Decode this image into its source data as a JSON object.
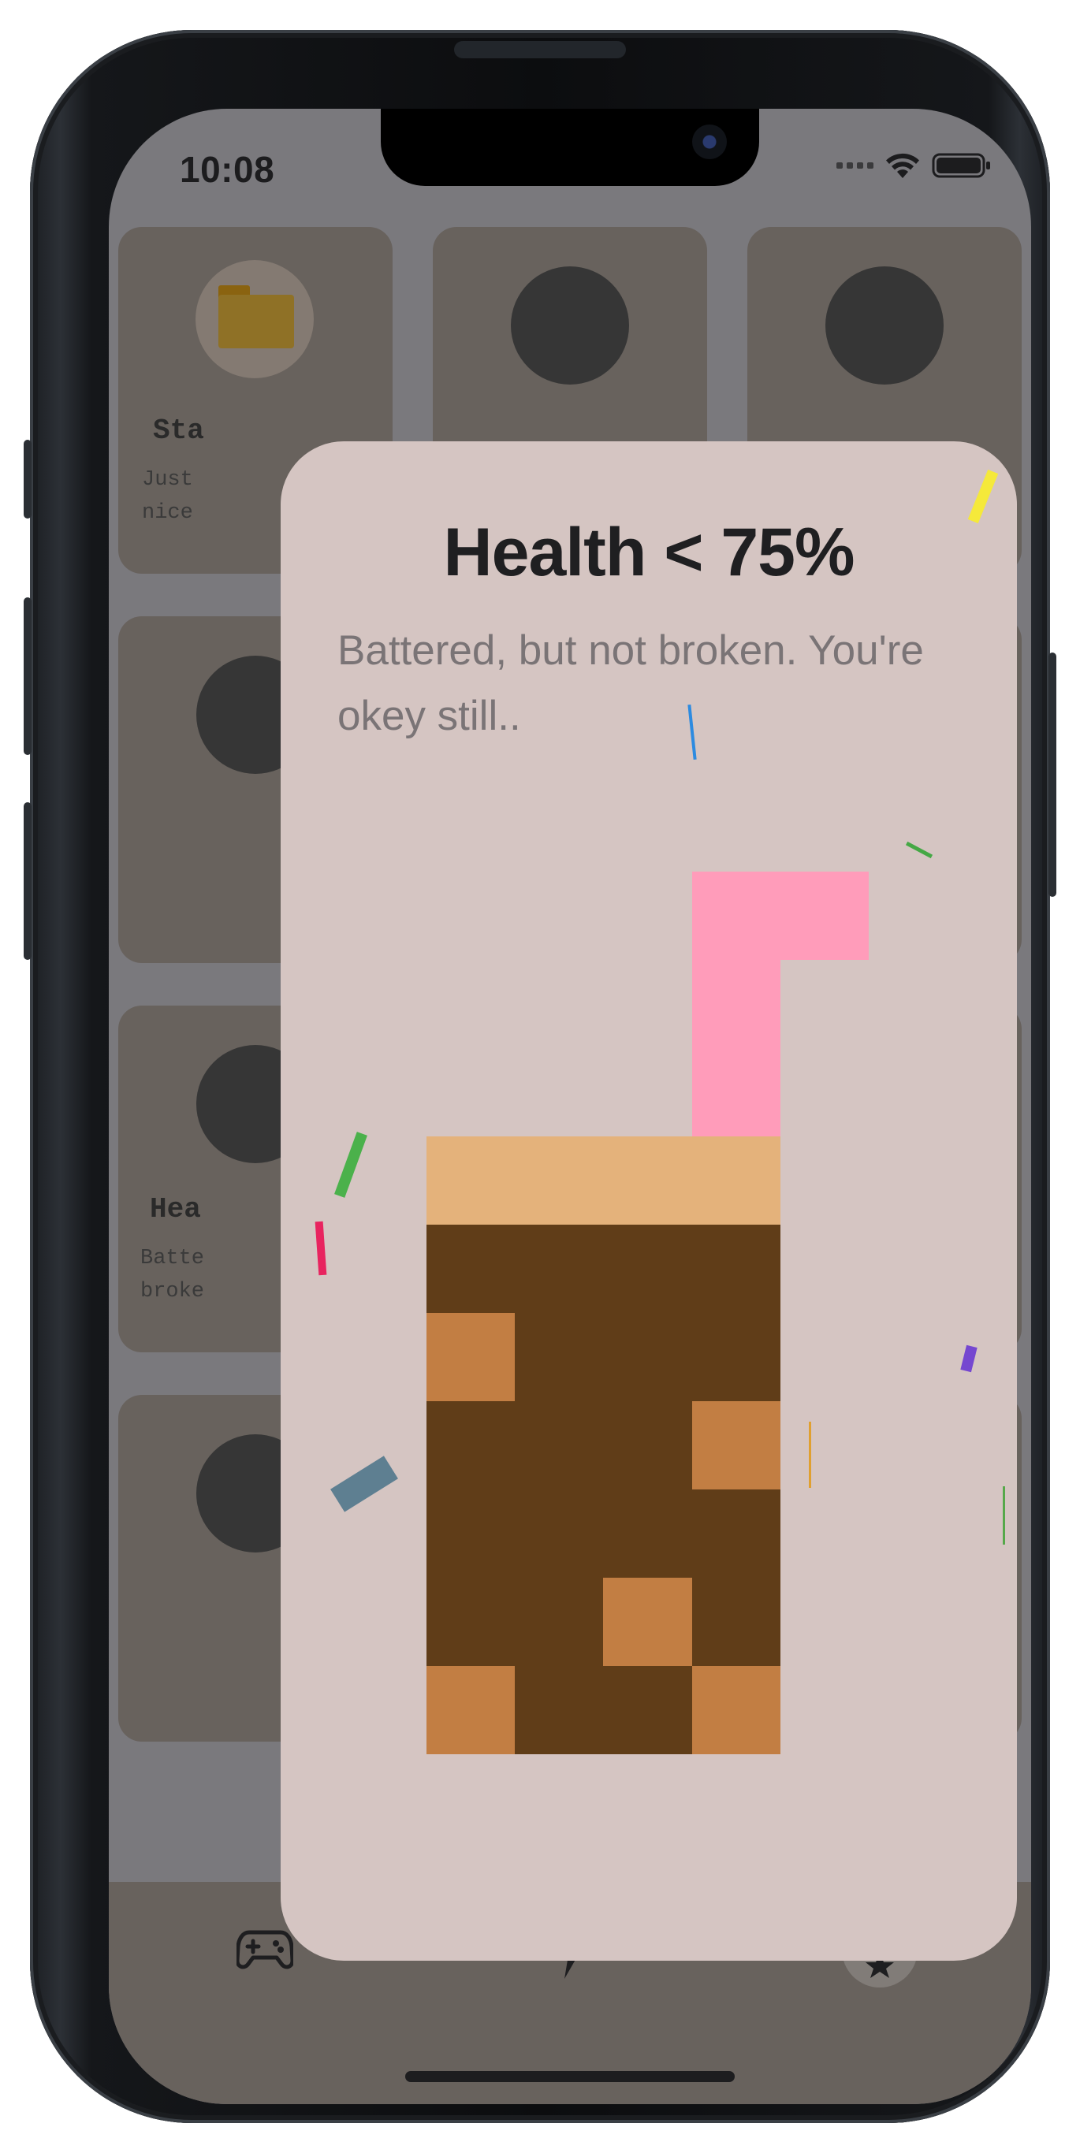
{
  "status_bar": {
    "time": "10:08",
    "icons": [
      "cellular-signal-icon",
      "wifi-icon",
      "battery-icon"
    ]
  },
  "background_grid": {
    "visible_cards": [
      {
        "title": "Sta",
        "description_lines": [
          "Just",
          "nice"
        ],
        "icon": "folder-icon"
      },
      {
        "title": "Hea",
        "description_lines": [
          "Batte",
          "broke"
        ],
        "icon": "circle-icon"
      }
    ]
  },
  "tab_bar": {
    "tabs": [
      {
        "name": "games",
        "icon": "gamepad-icon",
        "selected": false
      },
      {
        "name": "power",
        "icon": "lightning-bolt-icon",
        "selected": false
      },
      {
        "name": "achievements",
        "icon": "medal-icon",
        "selected": true
      }
    ]
  },
  "modal": {
    "title": "Health < 75%",
    "description": "Battered, but not broken. You're okey still..",
    "illustration": "pixel-coffee-cup-with-straw-icon"
  },
  "colors": {
    "modal_background": "#d5c5c2",
    "straw": "#ff9cba",
    "cup_rim": "#e4b27b",
    "coffee_dark": "#603d18",
    "coffee_light": "#c27e43",
    "dim_background": "#7a797d",
    "card_background": "#68625d"
  }
}
